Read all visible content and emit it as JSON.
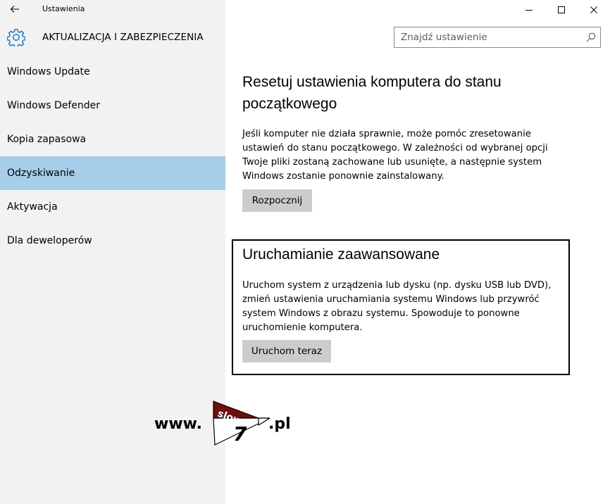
{
  "window": {
    "title": "Ustawienia",
    "controls": {
      "minimize": "–",
      "maximize": "☐",
      "close": "✕"
    }
  },
  "header": {
    "icon": "gear-icon",
    "title": "AKTUALIZACJA I ZABEZPIECZENIA",
    "search": {
      "placeholder": "Znajdź ustawienie",
      "value": ""
    }
  },
  "sidebar": {
    "items": [
      {
        "label": "Windows Update",
        "active": false
      },
      {
        "label": "Windows Defender",
        "active": false
      },
      {
        "label": "Kopia zapasowa",
        "active": false
      },
      {
        "label": "Odzyskiwanie",
        "active": true
      },
      {
        "label": "Aktywacja",
        "active": false
      },
      {
        "label": "Dla deweloperów",
        "active": false
      }
    ]
  },
  "main": {
    "reset": {
      "title_line1": "Resetuj ustawienia komputera do stanu",
      "title_line2": "początkowego",
      "text_lines": [
        "Jeśli komputer nie działa sprawnie, może pomóc zresetowanie",
        "ustawień do stanu początkowego. W zależności od wybranej opcji",
        "Twoje pliki zostaną zachowane lub usunięte, a następnie system",
        "Windows zostanie ponownie zainstalowany."
      ],
      "button_label": "Rozpocznij"
    },
    "advanced": {
      "title": "Uruchamianie zaawansowane",
      "text_lines": [
        "Uruchom system z urządzenia lub dysku (np. dysku USB lub DVD),",
        "zmień ustawienia uruchamiania systemu Windows lub przywróć",
        "system Windows z obrazu systemu. Spowoduje to ponowne",
        "uruchomienie komputera."
      ],
      "button_label": "Uruchom teraz"
    }
  },
  "watermark": {
    "prefix": "www.",
    "logo_text_top": "slow",
    "logo_text_digit": "7",
    "suffix": ".pl"
  },
  "colors": {
    "sidebar_bg": "#f2f2f2",
    "active_item": "#a6cdea",
    "button_bg": "#cccccc",
    "logo_red": "#6b0f0f"
  }
}
